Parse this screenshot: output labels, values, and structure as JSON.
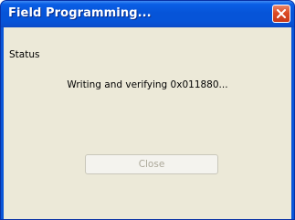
{
  "window": {
    "title": "Field Programming...",
    "close_icon": "close-icon",
    "titlebar_color": "#0654d8",
    "close_button_color": "#dc4b24"
  },
  "content": {
    "status_label": "Status",
    "status_message": "Writing and verifying 0x011880...",
    "close_button_label": "Close",
    "close_button_enabled": false,
    "background_color": "#ece9d8"
  }
}
